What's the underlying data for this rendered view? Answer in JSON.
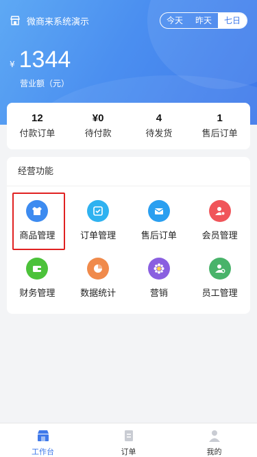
{
  "header": {
    "store_name": "微商来系统演示",
    "periods": [
      "今天",
      "昨天",
      "七日"
    ],
    "active_period": "七日",
    "currency": "¥",
    "amount": "1344",
    "amount_label": "营业额（元）"
  },
  "stats": [
    {
      "value": "12",
      "label": "付款订单"
    },
    {
      "value": "¥0",
      "label": "待付款"
    },
    {
      "value": "4",
      "label": "待发货"
    },
    {
      "value": "1",
      "label": "售后订单"
    }
  ],
  "functions": {
    "title": "经营功能",
    "items": [
      {
        "label": "商品管理",
        "icon": "product-icon",
        "color": "#3d8bf0"
      },
      {
        "label": "订单管理",
        "icon": "order-icon",
        "color": "#2fb2f0"
      },
      {
        "label": "售后订单",
        "icon": "after-sale-icon",
        "color": "#2a9ff0"
      },
      {
        "label": "会员管理",
        "icon": "member-icon",
        "color": "#f0555a"
      },
      {
        "label": "财务管理",
        "icon": "finance-icon",
        "color": "#4cc23a"
      },
      {
        "label": "数据统计",
        "icon": "statistics-icon",
        "color": "#f08a4b"
      },
      {
        "label": "营销",
        "icon": "marketing-icon",
        "color": "#8a5fe0"
      },
      {
        "label": "员工管理",
        "icon": "staff-icon",
        "color": "#49b36a"
      }
    ],
    "highlighted": "商品管理"
  },
  "tabbar": {
    "items": [
      {
        "label": "工作台",
        "icon": "workbench-icon"
      },
      {
        "label": "订单",
        "icon": "order-doc-icon"
      },
      {
        "label": "我的",
        "icon": "profile-icon"
      }
    ],
    "active": "工作台"
  },
  "colors": {
    "accent": "#3f79ea",
    "highlight_border": "#e02020"
  }
}
